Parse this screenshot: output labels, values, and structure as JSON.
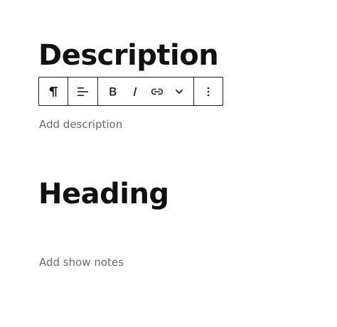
{
  "blocks": {
    "description_heading": "Description",
    "description_placeholder": "Add description",
    "second_heading": "Heading",
    "notes_placeholder": "Add show notes"
  },
  "toolbar": {
    "buttons": [
      {
        "name": "paragraph",
        "icon": "pilcrow-icon"
      },
      {
        "name": "align",
        "icon": "align-left-icon"
      },
      {
        "name": "bold",
        "icon": "bold-icon"
      },
      {
        "name": "italic",
        "icon": "italic-icon"
      },
      {
        "name": "link",
        "icon": "link-icon"
      },
      {
        "name": "more-formatting",
        "icon": "chevron-down-icon"
      },
      {
        "name": "options",
        "icon": "vertical-ellipsis-icon"
      }
    ]
  },
  "colors": {
    "text": "#111111",
    "placeholder": "#6b6b6b",
    "border": "#1e1e1e",
    "background": "#ffffff"
  }
}
